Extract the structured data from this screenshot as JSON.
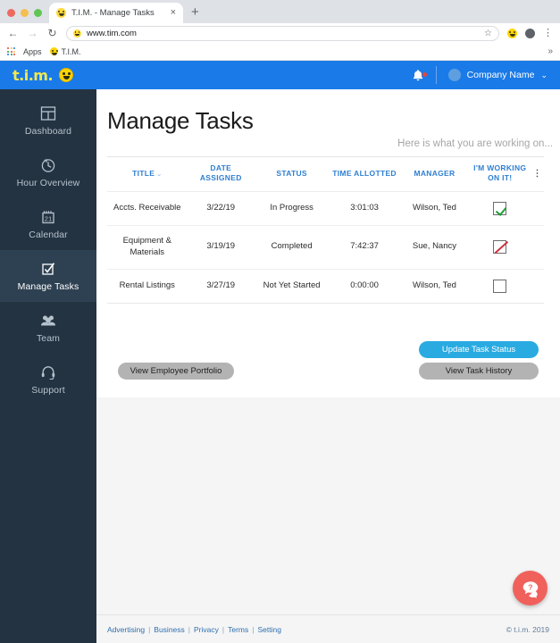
{
  "browser": {
    "tab": {
      "title": "T.I.M. - Manage Tasks",
      "favicon": "smiley-favicon",
      "close": "×"
    },
    "new_tab_label": "+",
    "nav": {
      "back": "←",
      "forward": "→",
      "reload": "↻"
    },
    "omnibox": {
      "url": "www.tim.com",
      "star": "☆"
    },
    "menu_glyph": "⋮",
    "bookmarks": {
      "apps_label": "Apps",
      "items": [
        {
          "label": "T.I.M."
        }
      ],
      "overflow": "»"
    }
  },
  "appbar": {
    "logo_text": "t.i.m.",
    "bell_label": "notifications",
    "company_name": "Company Name",
    "chevron": "⌄"
  },
  "sidebar": {
    "items": [
      {
        "label": "Dashboard",
        "icon": "dashboard-icon",
        "active": false
      },
      {
        "label": "Hour Overview",
        "icon": "clock-icon",
        "active": false
      },
      {
        "label": "Calendar",
        "icon": "calendar-icon",
        "active": false
      },
      {
        "label": "Manage Tasks",
        "icon": "checkbox-task-icon",
        "active": true
      },
      {
        "label": "Team",
        "icon": "people-icon",
        "active": false
      },
      {
        "label": "Support",
        "icon": "headset-icon",
        "active": false
      }
    ]
  },
  "main": {
    "title": "Manage Tasks",
    "subtitle": "Here is what you are working on...",
    "table": {
      "columns": [
        "TITLE",
        "DATE ASSIGNED",
        "STATUS",
        "TIME ALLOTTED",
        "MANAGER",
        "I'M WORKING ON IT!"
      ],
      "sort_chevron": "⌄",
      "row_menu_glyph": "⋮",
      "rows": [
        {
          "title": "Accts. Receivable",
          "date_assigned": "3/22/19",
          "status": "In Progress",
          "time_allotted": "3:01:03",
          "manager": "Wilson, Ted",
          "working_on_it": "checked"
        },
        {
          "title": "Equipment & Materials",
          "date_assigned": "3/19/19",
          "status": "Completed",
          "time_allotted": "7:42:37",
          "manager": "Sue, Nancy",
          "working_on_it": "slashed"
        },
        {
          "title": "Rental Listings",
          "date_assigned": "3/27/19",
          "status": "Not Yet Started",
          "time_allotted": "0:00:00",
          "manager": "Wilson, Ted",
          "working_on_it": "empty"
        }
      ]
    },
    "buttons": {
      "portfolio": "View Employee Portfolio",
      "update": "Update Task Status",
      "history": "View Task History"
    },
    "help_fab": "?"
  },
  "footer": {
    "links": [
      "Advertising",
      "Business",
      "Privacy",
      "Terms",
      "Setting"
    ],
    "separator": "|",
    "copyright": "© t.i.m. 2019"
  },
  "colors": {
    "brand_blue": "#1a7ae8",
    "sidebar": "#243342",
    "sidebar_active": "#2e4152",
    "accent_cyan": "#29abe2",
    "header_link": "#2f7fd1",
    "help_red": "#f0615c",
    "logo_yellow": "#f2e94e"
  }
}
